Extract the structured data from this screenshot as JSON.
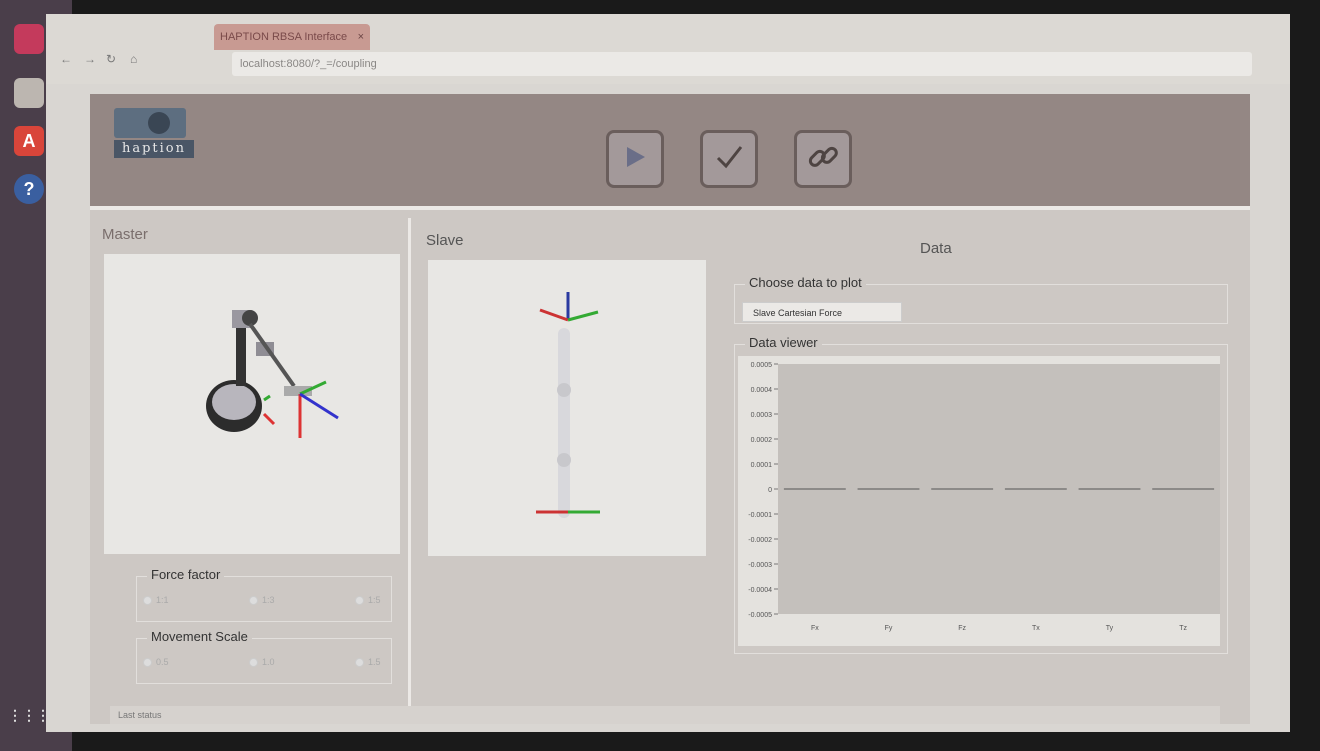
{
  "browser": {
    "tab_title": "HAPTION RBSA Interface",
    "tab_close": "×",
    "url": "localhost:8080/?_=/coupling",
    "nav": [
      "←",
      "→",
      "↻",
      "⌂"
    ]
  },
  "dock": {
    "help_label": "?"
  },
  "header": {
    "logo_text": "haption",
    "buttons": [
      "play-icon",
      "check-icon",
      "link-icon"
    ]
  },
  "master": {
    "title": "Master",
    "force_factor": {
      "label": "Force factor",
      "options": [
        "1:1",
        "1:3",
        "1:5"
      ],
      "selected": "1:1"
    },
    "movement_scale": {
      "label": "Movement Scale",
      "options": [
        "0.5",
        "1.0",
        "1.5"
      ],
      "selected": "1.0"
    }
  },
  "slave": {
    "title": "Slave"
  },
  "data": {
    "title": "Data",
    "choose_label": "Choose data to plot",
    "selected_option": "Slave Cartesian Force",
    "viewer_label": "Data viewer"
  },
  "status": {
    "text": "Last status"
  },
  "chart_data": {
    "type": "bar",
    "categories": [
      "Fx",
      "Fy",
      "Fz",
      "Tx",
      "Ty",
      "Tz"
    ],
    "values": [
      0,
      0,
      0,
      0,
      0,
      0
    ],
    "ylim": [
      -0.0005,
      0.0005
    ],
    "yticks": [
      "0.0005",
      "0.0004",
      "0.0003",
      "0.0002",
      "0.0001",
      "0",
      "-0.0001",
      "-0.0002",
      "-0.0003",
      "-0.0004",
      "-0.0005"
    ],
    "title": "",
    "xlabel": "",
    "ylabel": "",
    "grid": false
  }
}
